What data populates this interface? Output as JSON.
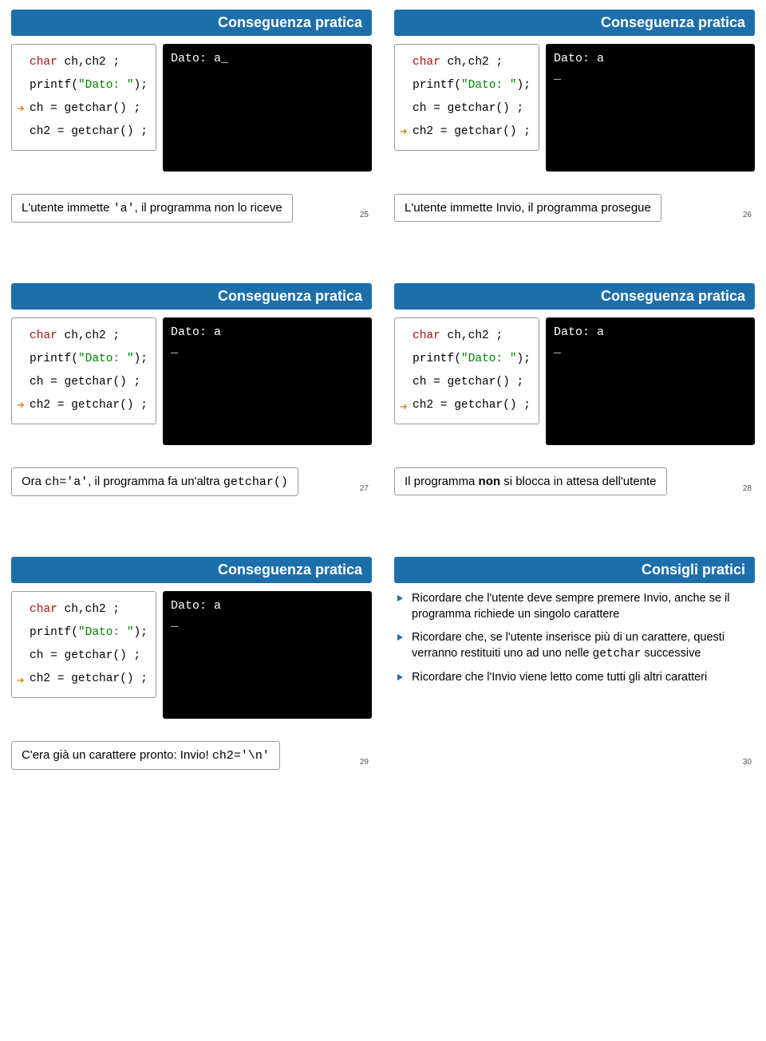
{
  "slides": {
    "s25": {
      "title": "Conseguenza pratica",
      "code": {
        "l1": "char ch,ch2 ;",
        "l2a": "printf(",
        "l2b": "\"Dato: \"",
        "l2c": ");",
        "l3": "ch = getchar() ;",
        "l4": "ch2 = getchar() ;"
      },
      "terminal": "Dato: a_",
      "caption_a": "L'utente immette ",
      "caption_b": "'a'",
      "caption_c": ", il programma non lo riceve",
      "page": "25"
    },
    "s26": {
      "title": "Conseguenza pratica",
      "code": {
        "l1": "char ch,ch2 ;",
        "l2a": "printf(",
        "l2b": "\"Dato: \"",
        "l2c": ");",
        "l3": "ch = getchar() ;",
        "l4": "ch2 = getchar() ;"
      },
      "terminal": "Dato: a\n_",
      "caption": "L'utente immette Invio, il programma prosegue",
      "page": "26"
    },
    "s27": {
      "title": "Conseguenza pratica",
      "code": {
        "l1": "char ch,ch2 ;",
        "l2a": "printf(",
        "l2b": "\"Dato: \"",
        "l2c": ");",
        "l3": "ch = getchar() ;",
        "l4": "ch2 = getchar() ;"
      },
      "terminal": "Dato: a\n_",
      "caption_a": "Ora ",
      "caption_b": "ch='a'",
      "caption_c": ", il programma fa un'altra ",
      "caption_d": "getchar()",
      "page": "27"
    },
    "s28": {
      "title": "Conseguenza pratica",
      "code": {
        "l1": "char ch,ch2 ;",
        "l2a": "printf(",
        "l2b": "\"Dato: \"",
        "l2c": ");",
        "l3": "ch = getchar() ;",
        "l4": "ch2 = getchar() ;"
      },
      "terminal": "Dato: a\n_",
      "caption_a": "Il programma ",
      "caption_b": "non",
      "caption_c": " si blocca in attesa dell'utente",
      "page": "28"
    },
    "s29": {
      "title": "Conseguenza pratica",
      "code": {
        "l1": "char ch,ch2 ;",
        "l2a": "printf(",
        "l2b": "\"Dato: \"",
        "l2c": ");",
        "l3": "ch = getchar() ;",
        "l4": "ch2 = getchar() ;"
      },
      "terminal": "Dato: a\n_",
      "caption_a": "C'era già un carattere pronto: Invio! ",
      "caption_b": "ch2='\\n'",
      "page": "29"
    },
    "s30": {
      "title": "Consigli pratici",
      "tips": {
        "t1": "Ricordare che l'utente deve sempre premere Invio, anche se il programma richiede un singolo carattere",
        "t2a": "Ricordare che, se l'utente inserisce più di un carattere, questi verranno restituiti uno ad uno nelle ",
        "t2b": "getchar",
        "t2c": " successive",
        "t3": "Ricordare che l'Invio viene letto come tutti gli altri caratteri"
      },
      "page": "30"
    }
  }
}
